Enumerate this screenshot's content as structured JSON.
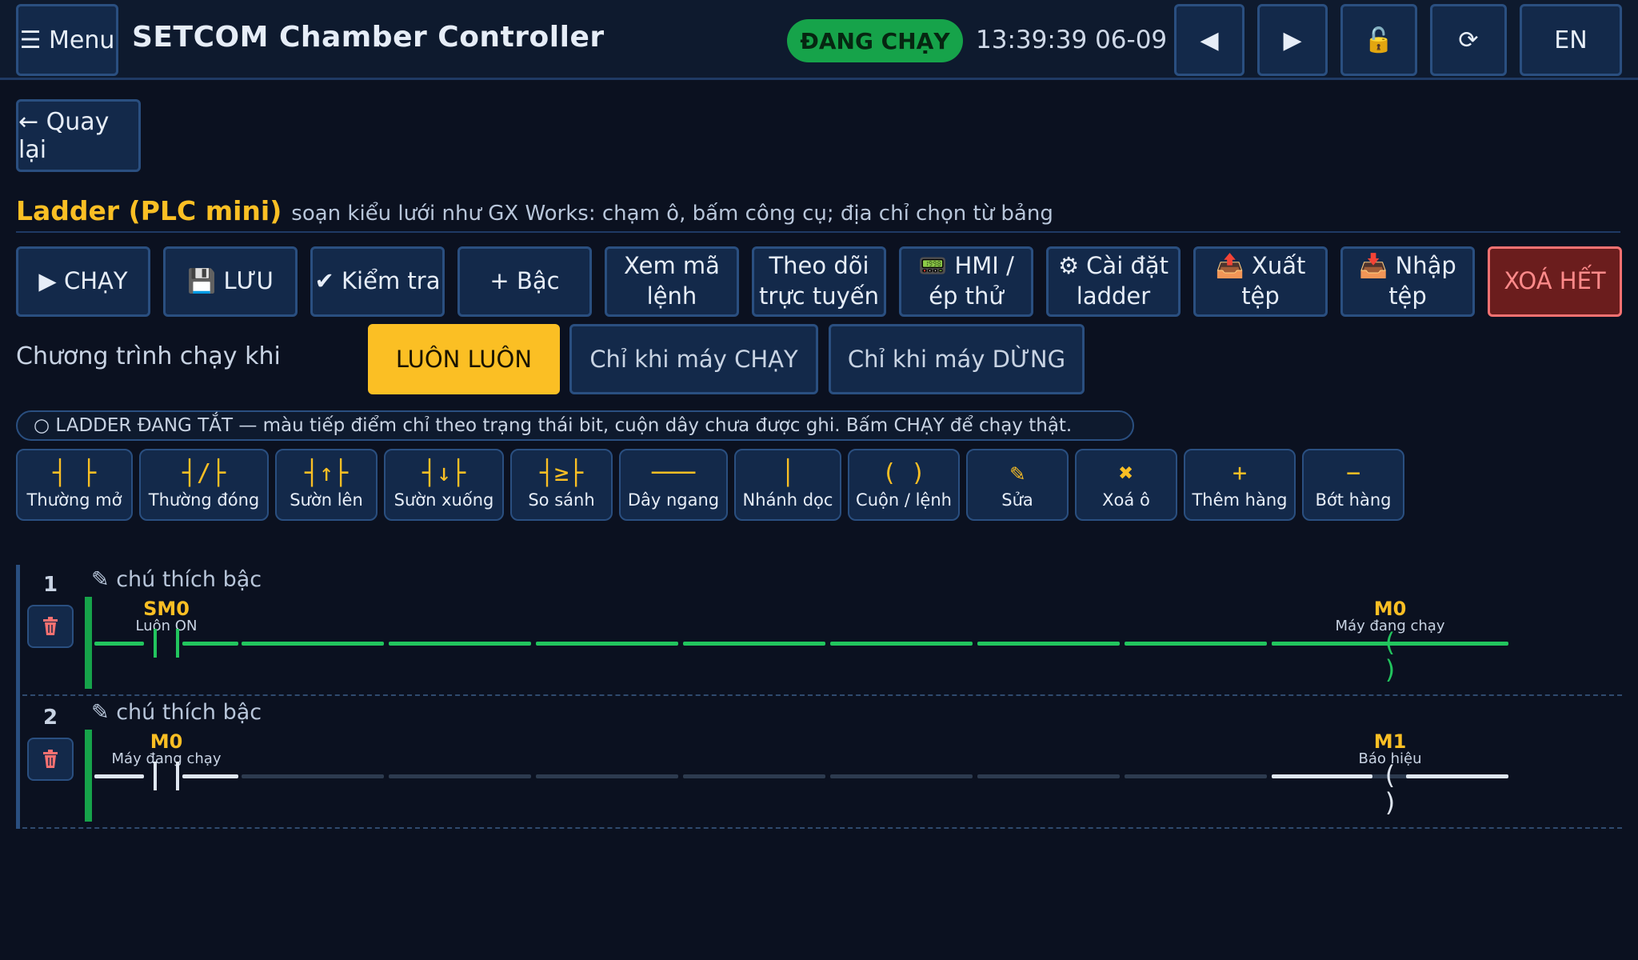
{
  "header": {
    "menu_label": "☰ Menu",
    "title": "SETCOM Chamber Controller",
    "status": "ĐANG CHẠY",
    "clock": "13:39:39 06-09",
    "nav_prev": "◀",
    "nav_next": "▶",
    "lock": "🔓",
    "refresh": "⟳",
    "lang": "EN"
  },
  "back_label": "← Quay lại",
  "page": {
    "title": "Ladder (PLC mini)",
    "subtitle": "soạn kiểu lưới như GX Works: chạm ô, bấm công cụ; địa chỉ chọn từ bảng"
  },
  "toolbar": [
    {
      "name": "run-button",
      "label": "▶ CHẠY"
    },
    {
      "name": "save-button",
      "label": "💾 LƯU"
    },
    {
      "name": "check-button",
      "label": "✔ Kiểm tra"
    },
    {
      "name": "add-rung-button",
      "label": "+ Bậc"
    },
    {
      "name": "view-code-button",
      "label": "Xem mã lệnh"
    },
    {
      "name": "monitor-button",
      "label": "Theo dõi trực tuyến"
    },
    {
      "name": "hmi-force-button",
      "label": "📟 HMI / ép thử"
    },
    {
      "name": "ladder-settings-button",
      "label": "⚙ Cài đặt ladder"
    },
    {
      "name": "export-button",
      "label": "📤 Xuất tệp"
    },
    {
      "name": "import-button",
      "label": "📥 Nhập tệp"
    },
    {
      "name": "clear-all-button",
      "label": "XOÁ HẾT"
    }
  ],
  "run_mode": {
    "label": "Chương trình chạy khi",
    "options": [
      "LUÔN LUÔN",
      "Chỉ khi máy CHẠY",
      "Chỉ khi máy DỪNG"
    ],
    "selected": "LUÔN LUÔN"
  },
  "notice": "○ LADDER ĐANG TẮT — màu tiếp điểm chỉ theo trạng thái bit, cuộn dây chưa được ghi. Bấm CHẠY để chạy thật.",
  "palette": [
    {
      "name": "normally-open-tool",
      "symbol": "┤ ├",
      "label": "Thường mở"
    },
    {
      "name": "normally-closed-tool",
      "symbol": "┤/├",
      "label": "Thường đóng"
    },
    {
      "name": "rising-edge-tool",
      "symbol": "┤↑├",
      "label": "Sườn lên"
    },
    {
      "name": "falling-edge-tool",
      "symbol": "┤↓├",
      "label": "Sườn xuống"
    },
    {
      "name": "compare-tool",
      "symbol": "┤≥├",
      "label": "So sánh"
    },
    {
      "name": "horizontal-wire-tool",
      "symbol": "───",
      "label": "Dây ngang"
    },
    {
      "name": "vertical-branch-tool",
      "symbol": "│",
      "label": "Nhánh dọc"
    },
    {
      "name": "coil-tool",
      "symbol": "( )",
      "label": "Cuộn / lệnh"
    },
    {
      "name": "edit-tool",
      "symbol": "✎",
      "label": "Sửa"
    },
    {
      "name": "delete-cell-tool",
      "symbol": "✖",
      "label": "Xoá ô"
    },
    {
      "name": "add-row-tool",
      "symbol": "+",
      "label": "Thêm hàng"
    },
    {
      "name": "remove-row-tool",
      "symbol": "−",
      "label": "Bớt hàng"
    }
  ],
  "rungs": [
    {
      "number": "1",
      "comment": "✎ chú thích bậc",
      "powered": true,
      "contact": {
        "address": "SM0",
        "description": "Luôn ON"
      },
      "coil": {
        "address": "M0",
        "description": "Máy đang chạy"
      }
    },
    {
      "number": "2",
      "comment": "✎ chú thích bậc",
      "powered": false,
      "contact": {
        "address": "M0",
        "description": "Máy đang chạy"
      },
      "coil": {
        "address": "M1",
        "description": "Báo hiệu"
      }
    }
  ],
  "colors": {
    "accent": "#fbbf24",
    "running": "#16a34a",
    "wire_on": "#22c55e",
    "danger": "#f87171"
  }
}
